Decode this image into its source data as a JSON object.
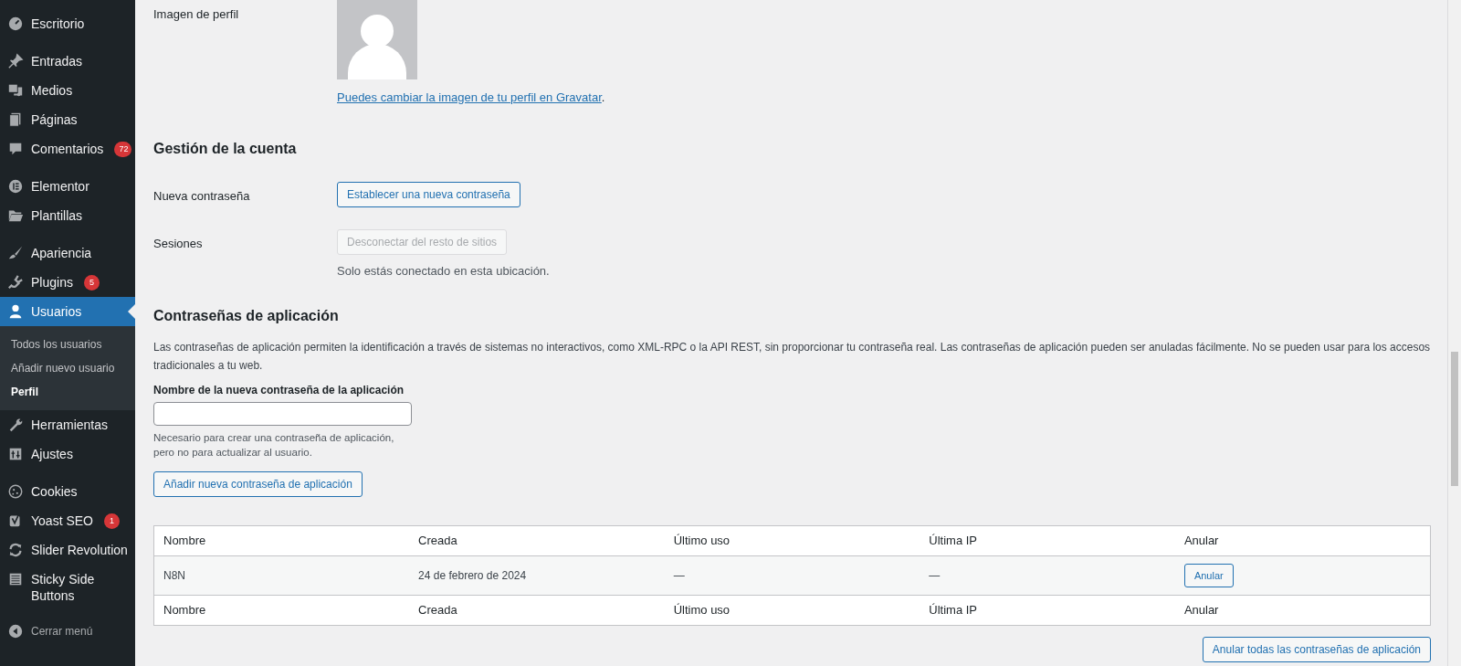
{
  "sidebar": {
    "groups": [
      {
        "items": [
          {
            "label": "Escritorio",
            "current": false
          }
        ]
      },
      {
        "items": [
          {
            "label": "Entradas",
            "current": false
          },
          {
            "label": "Medios",
            "current": false
          },
          {
            "label": "Páginas",
            "current": false
          },
          {
            "label": "Comentarios",
            "current": false,
            "badge": "72"
          }
        ]
      },
      {
        "items": [
          {
            "label": "Elementor",
            "current": false
          },
          {
            "label": "Plantillas",
            "current": false
          }
        ]
      },
      {
        "items": [
          {
            "label": "Apariencia",
            "current": false
          },
          {
            "label": "Plugins",
            "current": false,
            "badge": "5"
          },
          {
            "label": "Usuarios",
            "current": true,
            "children": [
              {
                "label": "Todos los usuarios",
                "selected": false
              },
              {
                "label": "Añadir nuevo usuario",
                "selected": false
              },
              {
                "label": "Perfil",
                "selected": true
              }
            ]
          },
          {
            "label": "Herramientas",
            "current": false
          },
          {
            "label": "Ajustes",
            "current": false
          }
        ]
      },
      {
        "items": [
          {
            "label": "Cookies",
            "current": false
          },
          {
            "label": "Yoast SEO",
            "current": false,
            "badge": "1"
          },
          {
            "label": "Slider Revolution",
            "current": false
          },
          {
            "label": "Sticky Side Buttons",
            "current": false
          }
        ]
      }
    ],
    "collapse": "Cerrar menú"
  },
  "profile_picture": {
    "label": "Imagen de perfil",
    "link": "Puedes cambiar la imagen de tu perfil en Gravatar",
    "suffix": "."
  },
  "account": {
    "heading": "Gestión de la cuenta",
    "rows": [
      {
        "label": "Nueva contraseña",
        "button": "Establecer una nueva contraseña",
        "disabled": false
      },
      {
        "label": "Sesiones",
        "button": "Desconectar del resto de sitios",
        "disabled": true,
        "note": "Solo estás conectado en esta ubicación."
      }
    ]
  },
  "app_passwords": {
    "heading": "Contraseñas de aplicación",
    "description": "Las contraseñas de aplicación permiten la identificación a través de sistemas no interactivos, como XML-RPC o la API REST, sin proporcionar tu contraseña real. Las contraseñas de aplicación pueden ser anuladas fácilmente. No se pueden usar para los accesos tradicionales a tu web.",
    "field_label": "Nombre de la nueva contraseña de la aplicación",
    "help": [
      "Necesario para crear una contraseña de aplicación,",
      "pero no para actualizar al usuario."
    ],
    "add_button": "Añadir nueva contraseña de aplicación",
    "table": {
      "columns": [
        "Nombre",
        "Creada",
        "Último uso",
        "Última IP",
        "Anular"
      ],
      "rows": [
        {
          "cells": [
            "N8N",
            "24 de febrero de 2024",
            "—",
            "—"
          ],
          "button": "Anular"
        }
      ],
      "footer": [
        "Nombre",
        "Creada",
        "Último uso",
        "Última IP",
        "Anular"
      ]
    },
    "revoke_all": "Anular todas las contraseñas de aplicación"
  }
}
